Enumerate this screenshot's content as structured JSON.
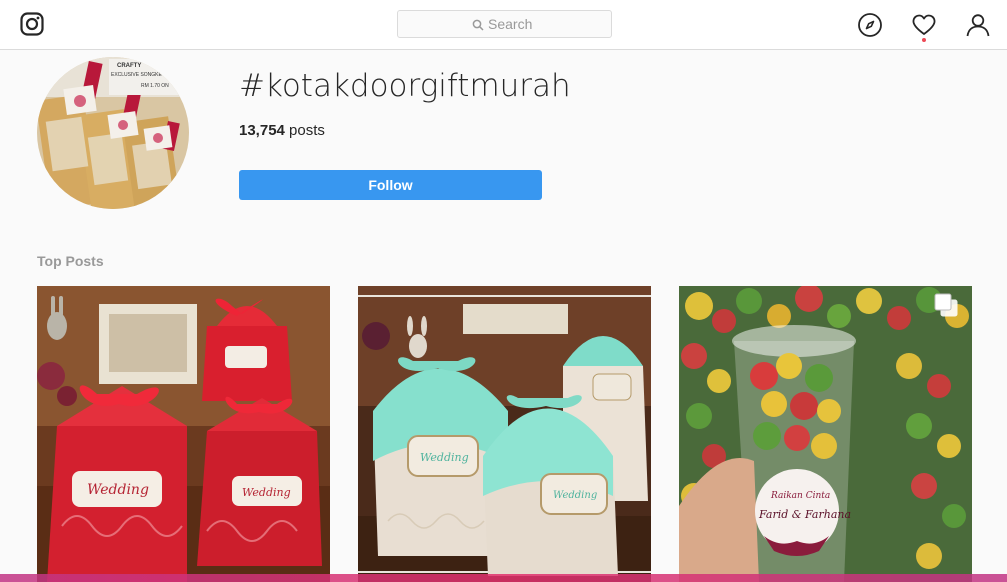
{
  "nav": {
    "search_placeholder": "Search",
    "icons": [
      "instagram-logo-icon",
      "search-icon",
      "compass-icon",
      "heart-icon",
      "user-icon"
    ],
    "notification_color": "#ed4956"
  },
  "header": {
    "hashtag": "#kotakdoorgiftmurah",
    "posts_count": "13,754",
    "posts_suffix": " posts",
    "follow_label": "Follow",
    "follow_color": "#3897f0"
  },
  "sections": {
    "top_posts_label": "Top Posts"
  },
  "avatar_tags": {
    "crafty": "CRAFTY",
    "exclusive": "EXCLUSIVE SONGKET",
    "price": "RM 1.70 ON"
  },
  "posts": [
    {
      "name": "red-wedding-gift-boxes",
      "label": "Wedding"
    },
    {
      "name": "mint-wedding-gift-boxes",
      "label": "Wedding"
    },
    {
      "name": "popcorn-cup-favours",
      "label": "Farid & Farhana",
      "sub_label": "Raikan Cinta",
      "multi": true
    }
  ]
}
